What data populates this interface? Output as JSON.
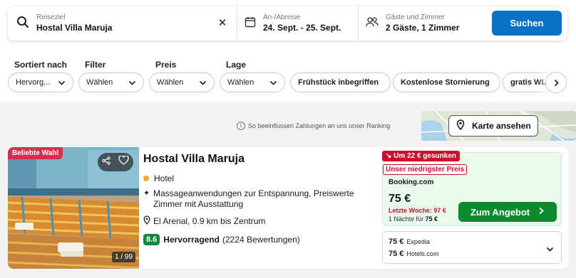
{
  "search": {
    "destination_label": "Reiseziel",
    "destination_value": "Hostal Villa Maruja",
    "dates_label": "An-/Abreise",
    "dates_value": "24. Sept. - 25. Sept.",
    "guests_label": "Gäste und Zimmer",
    "guests_value": "2 Gäste, 1 Zimmer",
    "submit_label": "Suchen",
    "clear_symbol": "✕"
  },
  "filters": {
    "sort": {
      "title": "Sortiert nach",
      "value": "Hervorg..."
    },
    "filter": {
      "title": "Filter",
      "value": "Wählen"
    },
    "price": {
      "title": "Preis",
      "value": "Wählen"
    },
    "location": {
      "title": "Lage",
      "value": "Wählen"
    },
    "chips": [
      "Frühstück inbegriffen",
      "Kostenlose Stornierung",
      "gratis WLAN"
    ]
  },
  "ranking_note": "So beeinflussen Zahlungen an uns unser Ranking",
  "map_button": "Karte ansehen",
  "hotel": {
    "badge": "Beliebte Wahl",
    "photo_counter": "1 / 99",
    "name": "Hostal Villa Maruja",
    "type": "Hotel",
    "amenities": "Massageanwendungen zur Entspannung, Preiswerte Zimmer mit Ausstattung",
    "location": "El Arenal, 0.9 km bis Zentrum",
    "score": "8.6",
    "rating_word": "Hervorragend",
    "reviews": "(2224 Bewertungen)"
  },
  "deal": {
    "drop_tag": "Um 22 € gesunken",
    "lowest_tag": "Unser niedrigster Preis",
    "provider": "Booking.com",
    "price": "75 €",
    "last_week": "Letzte Woche: 97 €",
    "nights_prefix": "1 Nächte für",
    "nights_price": "75 €",
    "button": "Zum Angebot"
  },
  "other_offers": [
    {
      "price": "75 €",
      "provider": "Expedia"
    },
    {
      "price": "75 €",
      "provider": "Hotels.com"
    }
  ],
  "colors": {
    "primary_blue": "#0a72c6",
    "deal_green": "#0e8a2e",
    "badge_red": "#d12f4d",
    "tag_red": "#c8102e",
    "score_green": "#0e8a3a",
    "type_dot": "#f5a623"
  }
}
